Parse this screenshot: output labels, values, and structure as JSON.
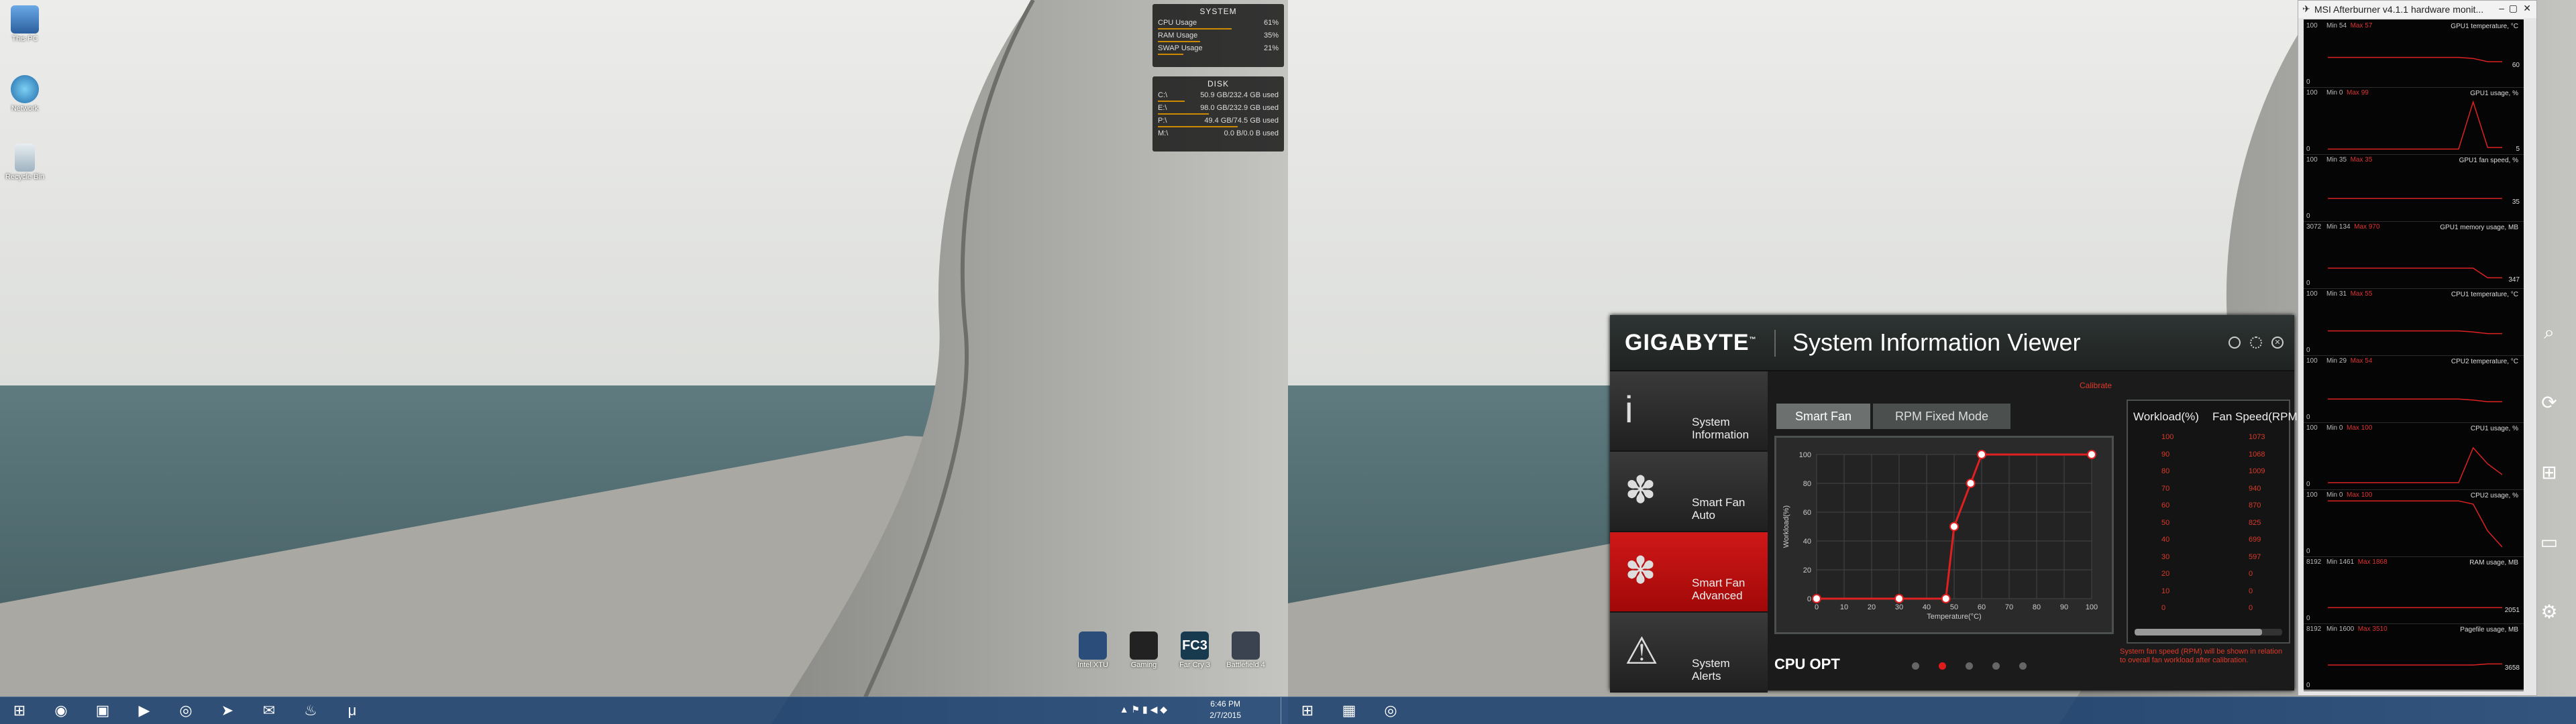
{
  "desktop_left": {
    "icons": [
      {
        "label": "This PC",
        "icon": "computer-icon"
      },
      {
        "label": "Network",
        "icon": "network-icon"
      },
      {
        "label": "Recycle Bin",
        "icon": "recycle-bin-icon"
      }
    ],
    "shortcuts": [
      {
        "label": "Intel XTU",
        "icon": "app-icon"
      },
      {
        "label": "Gaming",
        "icon": "app-icon"
      },
      {
        "label": "Far Cry 3",
        "icon": "far-cry-icon"
      },
      {
        "label": "Battlefield 4",
        "icon": "soldier-icon"
      }
    ]
  },
  "system_widget": {
    "title": "SYSTEM",
    "rows": [
      {
        "label": "CPU Usage",
        "value": "61%",
        "fill": 0.61
      },
      {
        "label": "RAM Usage",
        "value": "35%",
        "fill": 0.35
      },
      {
        "label": "SWAP Usage",
        "value": "21%",
        "fill": 0.21
      }
    ]
  },
  "disk_widget": {
    "title": "DISK",
    "rows": [
      {
        "label": "C:\\",
        "value": "50.9 GB/232.4 GB used",
        "fill": 0.22
      },
      {
        "label": "E:\\",
        "value": "98.0 GB/232.9 GB used",
        "fill": 0.42
      },
      {
        "label": "P:\\",
        "value": "49.4 GB/74.5 GB used",
        "fill": 0.66
      },
      {
        "label": "M:\\",
        "value": "0.0 B/0.0 B used",
        "fill": 0.0
      }
    ]
  },
  "taskbar_left": {
    "clock_time": "6:46 PM",
    "clock_date": "2/7/2015",
    "pinned": [
      "start-icon",
      "chrome-icon",
      "folder-icon",
      "media-player-icon",
      "vpn-icon",
      "telegram-icon",
      "mail-icon",
      "steam-icon",
      "utorrent-icon"
    ]
  },
  "taskbar_right": {
    "pinned": [
      "start-icon",
      "gpu-icon",
      "vpn-icon"
    ]
  },
  "siv": {
    "brand": "GIGABYTE",
    "brand_tm": "™",
    "title": "System Information Viewer",
    "nav": [
      {
        "label": "System\nInformation",
        "icon": "info-icon",
        "active": false
      },
      {
        "label": "Smart Fan\nAuto",
        "icon": "fan-icon",
        "active": false
      },
      {
        "label": "Smart Fan\nAdvanced",
        "icon": "fan-advanced-icon",
        "active": true
      },
      {
        "label": "System\nAlerts",
        "icon": "warning-icon",
        "active": false
      }
    ],
    "tabs": [
      {
        "label": "Smart Fan",
        "selected": true
      },
      {
        "label": "RPM Fixed Mode",
        "selected": false
      }
    ],
    "calibrate_label": "Calibrate",
    "chart_data": {
      "type": "line",
      "xlabel": "Temperature(°C)",
      "ylabel": "Workload(%)",
      "x_ticks": [
        0,
        10,
        20,
        30,
        40,
        50,
        60,
        70,
        80,
        90,
        100
      ],
      "y_ticks": [
        0,
        20,
        40,
        60,
        80,
        100
      ],
      "xlim": [
        0,
        100
      ],
      "ylim": [
        0,
        100
      ],
      "points": [
        {
          "x": 0,
          "y": 0
        },
        {
          "x": 30,
          "y": 0
        },
        {
          "x": 47,
          "y": 0
        },
        {
          "x": 50,
          "y": 50
        },
        {
          "x": 56,
          "y": 80
        },
        {
          "x": 60,
          "y": 100
        },
        {
          "x": 100,
          "y": 100
        }
      ],
      "line_color": "#e02020"
    },
    "table": {
      "col1": "Workload(%)",
      "col2": "Fan Speed(RPM)",
      "rows": [
        [
          "100",
          "1073"
        ],
        [
          "90",
          "1068"
        ],
        [
          "80",
          "1009"
        ],
        [
          "70",
          "940"
        ],
        [
          "60",
          "870"
        ],
        [
          "50",
          "825"
        ],
        [
          "40",
          "699"
        ],
        [
          "30",
          "597"
        ],
        [
          "20",
          "0"
        ],
        [
          "10",
          "0"
        ],
        [
          "0",
          "0"
        ]
      ]
    },
    "profile_label": "CPU OPT",
    "page_dots": [
      false,
      true,
      false,
      false,
      false
    ],
    "note": "System fan speed (RPM) will be shown in relation to overall fan workload after calibration."
  },
  "afterburner": {
    "title": "MSI Afterburner v4.1.1 hardware monit...",
    "graphs": [
      {
        "label": "GPU1 temperature, °C",
        "min": "54",
        "max": "57",
        "scale_top": "100",
        "scale_bottom": "0",
        "current": "60",
        "profile": [
          0.48,
          0.48,
          0.48,
          0.48,
          0.48,
          0.48,
          0.48,
          0.48,
          0.48,
          0.48,
          0.46,
          0.4,
          0.4
        ]
      },
      {
        "label": "GPU1 usage, %",
        "min": "0",
        "max": "99",
        "scale_top": "100",
        "scale_bottom": "0",
        "current": "5",
        "profile": [
          0.02,
          0.02,
          0.02,
          0.02,
          0.02,
          0.02,
          0.02,
          0.02,
          0.02,
          0.02,
          0.9,
          0.05,
          0.05
        ]
      },
      {
        "label": "GPU1 fan speed, %",
        "min": "35",
        "max": "35",
        "scale_top": "100",
        "scale_bottom": "0",
        "current": "35",
        "profile": [
          0.35,
          0.35,
          0.35,
          0.35,
          0.35,
          0.35,
          0.35,
          0.35,
          0.35,
          0.35,
          0.35,
          0.35,
          0.35
        ]
      },
      {
        "label": "GPU1 memory usage, MB",
        "min": "134",
        "max": "970",
        "scale_top": "3072",
        "scale_bottom": "0",
        "current": "347",
        "profile": [
          0.3,
          0.3,
          0.3,
          0.3,
          0.3,
          0.3,
          0.3,
          0.3,
          0.3,
          0.3,
          0.3,
          0.12,
          0.12
        ]
      },
      {
        "label": "CPU1 temperature, °C",
        "min": "31",
        "max": "55",
        "scale_top": "100",
        "scale_bottom": "0",
        "current": "",
        "profile": [
          0.38,
          0.38,
          0.38,
          0.38,
          0.38,
          0.38,
          0.38,
          0.38,
          0.38,
          0.38,
          0.36,
          0.33,
          0.33
        ]
      },
      {
        "label": "CPU2 temperature, °C",
        "min": "29",
        "max": "54",
        "scale_top": "100",
        "scale_bottom": "0",
        "current": "",
        "profile": [
          0.36,
          0.36,
          0.36,
          0.36,
          0.36,
          0.36,
          0.36,
          0.36,
          0.36,
          0.36,
          0.34,
          0.31,
          0.31
        ]
      },
      {
        "label": "CPU1 usage, %",
        "min": "0",
        "max": "100",
        "scale_top": "100",
        "scale_bottom": "0",
        "current": "",
        "profile": [
          0.05,
          0.05,
          0.05,
          0.05,
          0.05,
          0.05,
          0.05,
          0.05,
          0.05,
          0.05,
          0.7,
          0.4,
          0.2
        ]
      },
      {
        "label": "CPU2 usage, %",
        "min": "0",
        "max": "100",
        "scale_top": "100",
        "scale_bottom": "0",
        "current": "",
        "profile": [
          0.96,
          0.96,
          0.96,
          0.96,
          0.96,
          0.96,
          0.96,
          0.96,
          0.96,
          0.96,
          0.9,
          0.4,
          0.1
        ]
      },
      {
        "label": "RAM usage, MB",
        "min": "1461",
        "max": "1868",
        "scale_top": "8192",
        "scale_bottom": "0",
        "current": "2051",
        "profile": [
          0.22,
          0.22,
          0.22,
          0.22,
          0.22,
          0.22,
          0.22,
          0.22,
          0.22,
          0.22,
          0.22,
          0.22,
          0.22
        ]
      },
      {
        "label": "Pagefile usage, MB",
        "min": "1600",
        "max": "3510",
        "scale_top": "8192",
        "scale_bottom": "0",
        "current": "3658",
        "profile": [
          0.4,
          0.4,
          0.4,
          0.4,
          0.4,
          0.4,
          0.4,
          0.4,
          0.4,
          0.4,
          0.4,
          0.42,
          0.42
        ]
      }
    ]
  },
  "charms": [
    "search-icon",
    "share-icon",
    "start-icon",
    "devices-icon",
    "settings-icon"
  ]
}
